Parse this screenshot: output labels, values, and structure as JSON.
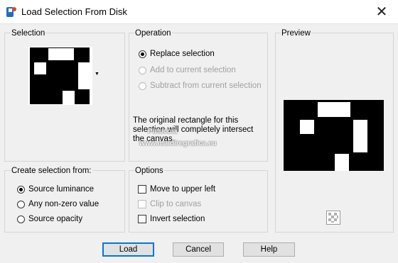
{
  "window": {
    "title": "Load Selection From Disk",
    "close_label": "✕"
  },
  "selection": {
    "label": "Selection"
  },
  "operation": {
    "label": "Operation",
    "options": [
      {
        "label": "Replace selection",
        "checked": true,
        "disabled": false
      },
      {
        "label": "Add to current selection",
        "checked": false,
        "disabled": true
      },
      {
        "label": "Subtract from current selection",
        "checked": false,
        "disabled": true
      }
    ],
    "description": "The original rectangle for this selection will completely intersect the canvas."
  },
  "preview": {
    "label": "Preview"
  },
  "create_from": {
    "label": "Create selection from:",
    "options": [
      {
        "label": "Source luminance",
        "checked": true
      },
      {
        "label": "Any non-zero value",
        "checked": false
      },
      {
        "label": "Source opacity",
        "checked": false
      }
    ]
  },
  "options": {
    "label": "Options",
    "items": [
      {
        "label": "Move to upper left",
        "checked": false,
        "disabled": false
      },
      {
        "label": "Clip to canvas",
        "checked": false,
        "disabled": true
      },
      {
        "label": "Invert selection",
        "checked": false,
        "disabled": false
      }
    ]
  },
  "buttons": {
    "load": "Load",
    "cancel": "Cancel",
    "help": "Help"
  },
  "watermark": {
    "line1": "Pinuccia",
    "line2": "www.maidiregrafica.eu"
  }
}
